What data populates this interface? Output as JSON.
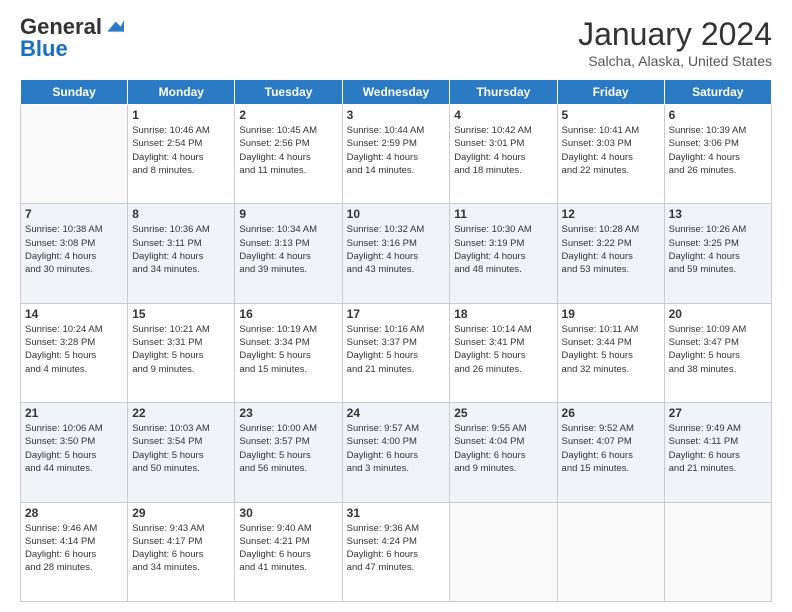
{
  "header": {
    "logo_general": "General",
    "logo_blue": "Blue",
    "month_year": "January 2024",
    "location": "Salcha, Alaska, United States"
  },
  "days_of_week": [
    "Sunday",
    "Monday",
    "Tuesday",
    "Wednesday",
    "Thursday",
    "Friday",
    "Saturday"
  ],
  "weeks": [
    [
      {
        "day": "",
        "info": ""
      },
      {
        "day": "1",
        "info": "Sunrise: 10:46 AM\nSunset: 2:54 PM\nDaylight: 4 hours\nand 8 minutes."
      },
      {
        "day": "2",
        "info": "Sunrise: 10:45 AM\nSunset: 2:56 PM\nDaylight: 4 hours\nand 11 minutes."
      },
      {
        "day": "3",
        "info": "Sunrise: 10:44 AM\nSunset: 2:59 PM\nDaylight: 4 hours\nand 14 minutes."
      },
      {
        "day": "4",
        "info": "Sunrise: 10:42 AM\nSunset: 3:01 PM\nDaylight: 4 hours\nand 18 minutes."
      },
      {
        "day": "5",
        "info": "Sunrise: 10:41 AM\nSunset: 3:03 PM\nDaylight: 4 hours\nand 22 minutes."
      },
      {
        "day": "6",
        "info": "Sunrise: 10:39 AM\nSunset: 3:06 PM\nDaylight: 4 hours\nand 26 minutes."
      }
    ],
    [
      {
        "day": "7",
        "info": "Sunrise: 10:38 AM\nSunset: 3:08 PM\nDaylight: 4 hours\nand 30 minutes."
      },
      {
        "day": "8",
        "info": "Sunrise: 10:36 AM\nSunset: 3:11 PM\nDaylight: 4 hours\nand 34 minutes."
      },
      {
        "day": "9",
        "info": "Sunrise: 10:34 AM\nSunset: 3:13 PM\nDaylight: 4 hours\nand 39 minutes."
      },
      {
        "day": "10",
        "info": "Sunrise: 10:32 AM\nSunset: 3:16 PM\nDaylight: 4 hours\nand 43 minutes."
      },
      {
        "day": "11",
        "info": "Sunrise: 10:30 AM\nSunset: 3:19 PM\nDaylight: 4 hours\nand 48 minutes."
      },
      {
        "day": "12",
        "info": "Sunrise: 10:28 AM\nSunset: 3:22 PM\nDaylight: 4 hours\nand 53 minutes."
      },
      {
        "day": "13",
        "info": "Sunrise: 10:26 AM\nSunset: 3:25 PM\nDaylight: 4 hours\nand 59 minutes."
      }
    ],
    [
      {
        "day": "14",
        "info": "Sunrise: 10:24 AM\nSunset: 3:28 PM\nDaylight: 5 hours\nand 4 minutes."
      },
      {
        "day": "15",
        "info": "Sunrise: 10:21 AM\nSunset: 3:31 PM\nDaylight: 5 hours\nand 9 minutes."
      },
      {
        "day": "16",
        "info": "Sunrise: 10:19 AM\nSunset: 3:34 PM\nDaylight: 5 hours\nand 15 minutes."
      },
      {
        "day": "17",
        "info": "Sunrise: 10:16 AM\nSunset: 3:37 PM\nDaylight: 5 hours\nand 21 minutes."
      },
      {
        "day": "18",
        "info": "Sunrise: 10:14 AM\nSunset: 3:41 PM\nDaylight: 5 hours\nand 26 minutes."
      },
      {
        "day": "19",
        "info": "Sunrise: 10:11 AM\nSunset: 3:44 PM\nDaylight: 5 hours\nand 32 minutes."
      },
      {
        "day": "20",
        "info": "Sunrise: 10:09 AM\nSunset: 3:47 PM\nDaylight: 5 hours\nand 38 minutes."
      }
    ],
    [
      {
        "day": "21",
        "info": "Sunrise: 10:06 AM\nSunset: 3:50 PM\nDaylight: 5 hours\nand 44 minutes."
      },
      {
        "day": "22",
        "info": "Sunrise: 10:03 AM\nSunset: 3:54 PM\nDaylight: 5 hours\nand 50 minutes."
      },
      {
        "day": "23",
        "info": "Sunrise: 10:00 AM\nSunset: 3:57 PM\nDaylight: 5 hours\nand 56 minutes."
      },
      {
        "day": "24",
        "info": "Sunrise: 9:57 AM\nSunset: 4:00 PM\nDaylight: 6 hours\nand 3 minutes."
      },
      {
        "day": "25",
        "info": "Sunrise: 9:55 AM\nSunset: 4:04 PM\nDaylight: 6 hours\nand 9 minutes."
      },
      {
        "day": "26",
        "info": "Sunrise: 9:52 AM\nSunset: 4:07 PM\nDaylight: 6 hours\nand 15 minutes."
      },
      {
        "day": "27",
        "info": "Sunrise: 9:49 AM\nSunset: 4:11 PM\nDaylight: 6 hours\nand 21 minutes."
      }
    ],
    [
      {
        "day": "28",
        "info": "Sunrise: 9:46 AM\nSunset: 4:14 PM\nDaylight: 6 hours\nand 28 minutes."
      },
      {
        "day": "29",
        "info": "Sunrise: 9:43 AM\nSunset: 4:17 PM\nDaylight: 6 hours\nand 34 minutes."
      },
      {
        "day": "30",
        "info": "Sunrise: 9:40 AM\nSunset: 4:21 PM\nDaylight: 6 hours\nand 41 minutes."
      },
      {
        "day": "31",
        "info": "Sunrise: 9:36 AM\nSunset: 4:24 PM\nDaylight: 6 hours\nand 47 minutes."
      },
      {
        "day": "",
        "info": ""
      },
      {
        "day": "",
        "info": ""
      },
      {
        "day": "",
        "info": ""
      }
    ]
  ]
}
